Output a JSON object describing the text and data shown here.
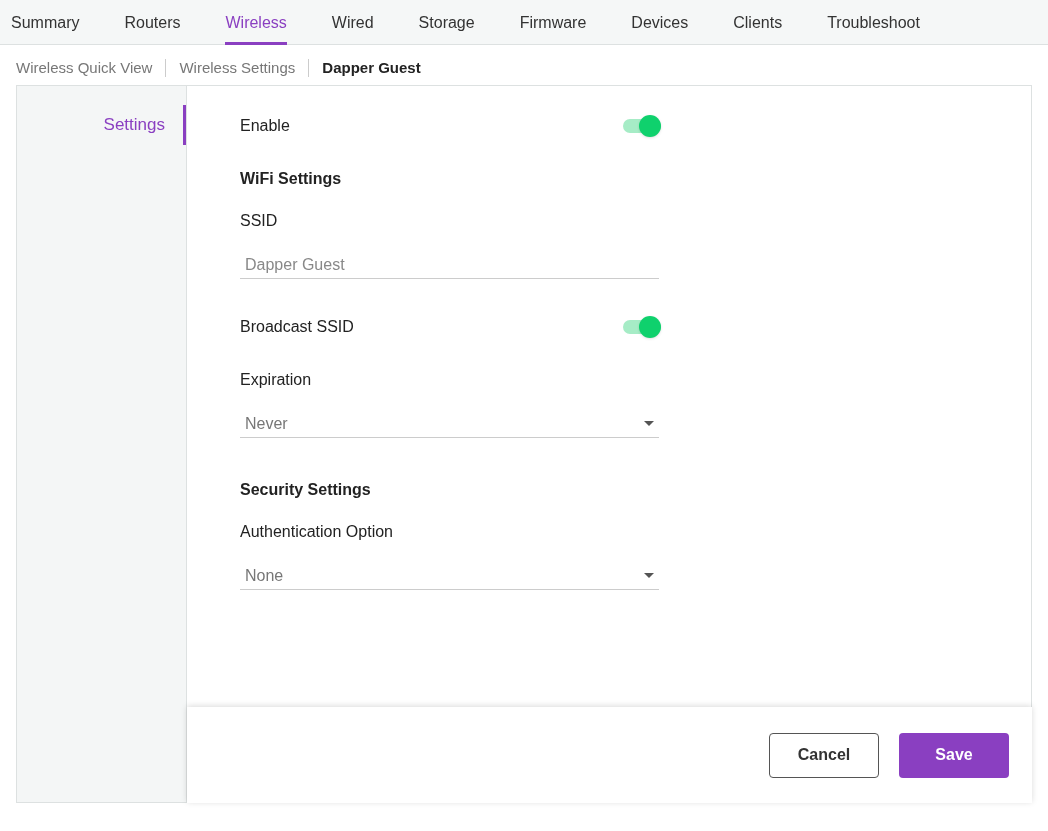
{
  "nav_tabs": [
    {
      "label": "Summary",
      "selected": false
    },
    {
      "label": "Routers",
      "selected": false
    },
    {
      "label": "Wireless",
      "selected": true
    },
    {
      "label": "Wired",
      "selected": false
    },
    {
      "label": "Storage",
      "selected": false
    },
    {
      "label": "Firmware",
      "selected": false
    },
    {
      "label": "Devices",
      "selected": false
    },
    {
      "label": "Clients",
      "selected": false
    },
    {
      "label": "Troubleshoot",
      "selected": false
    }
  ],
  "breadcrumb": [
    "Wireless Quick View",
    "Wireless Settings",
    "Dapper Guest"
  ],
  "sidebar": {
    "items": [
      {
        "label": "Settings",
        "selected": true
      }
    ]
  },
  "form": [
    {
      "kind": "toggle",
      "label": "Enable",
      "on": true
    },
    {
      "kind": "heading",
      "label": "WiFi Settings"
    },
    {
      "kind": "input",
      "label": "SSID",
      "placeholder": "Dapper Guest"
    },
    {
      "kind": "toggle",
      "label": "Broadcast SSID",
      "on": true
    },
    {
      "kind": "select",
      "label": "Expiration",
      "value": "Never"
    },
    {
      "kind": "heading",
      "label": "Security Settings"
    },
    {
      "kind": "select",
      "label": "Authentication Option",
      "value": "None"
    }
  ],
  "buttons": [
    {
      "label": "Cancel",
      "kind": "secondary"
    },
    {
      "label": "Save",
      "kind": "primary"
    }
  ]
}
